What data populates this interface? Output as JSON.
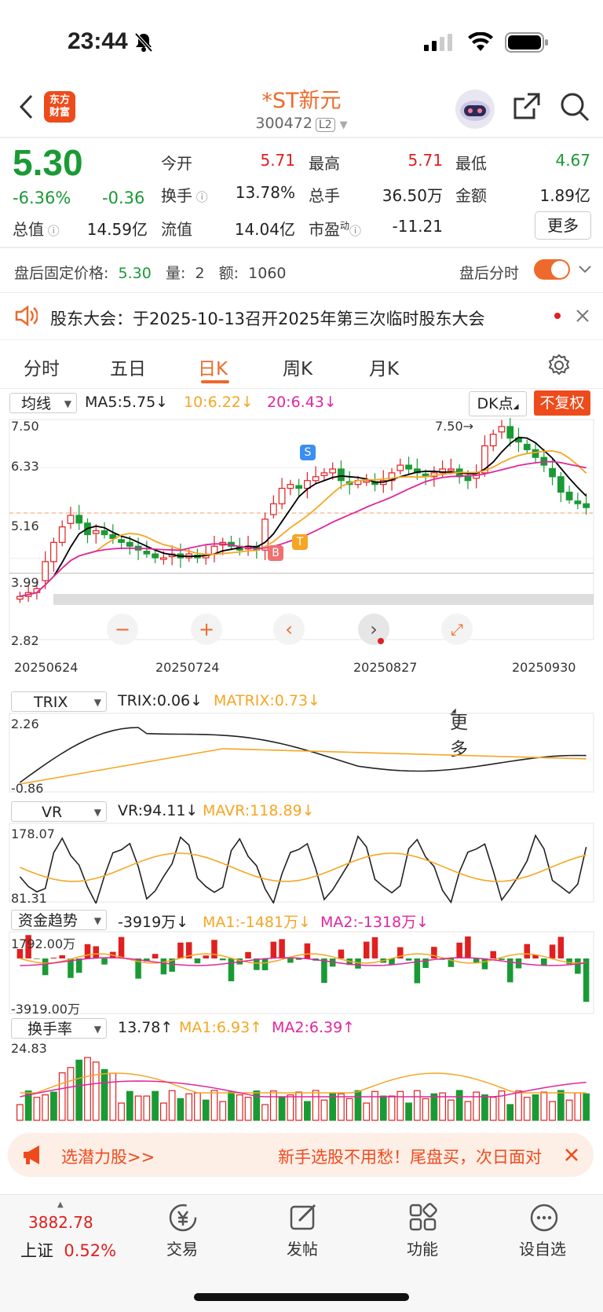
{
  "status_bar": {
    "time": "23:44"
  },
  "header": {
    "logo_text": "东方\n财富",
    "title": "*ST新元",
    "code": "300472",
    "level": "L2"
  },
  "quote": {
    "price": "5.30",
    "change_pct": "-6.36%",
    "change": "-0.36",
    "open_label": "今开",
    "open": "5.71",
    "high_label": "最高",
    "high": "5.71",
    "low_label": "最低",
    "low": "4.67",
    "turnover_label": "换手",
    "turnover": "13.78%",
    "volume_label": "总手",
    "volume": "36.50万",
    "amount_label": "金额",
    "amount": "1.89亿",
    "mktcap_label": "总值",
    "mktcap": "14.59亿",
    "float_label": "流值",
    "float": "14.04亿",
    "pe_label": "市盈",
    "pe_sup": "动",
    "pe": "-11.21",
    "more": "更多"
  },
  "after_hours": {
    "label": "盘后固定价格:",
    "price": "5.30",
    "vol_label": "量:",
    "vol": "2",
    "amt_label": "额:",
    "amt": "1060",
    "timeshare": "盘后分时"
  },
  "notice": {
    "text": "股东大会：于2025-10-13召开2025年第三次临时股东大会"
  },
  "tabs": [
    "分时",
    "五日",
    "日K",
    "周K",
    "月K",
    "更多"
  ],
  "active_tab": "日K",
  "kline": {
    "ma_selector": "均线",
    "ma5": "MA5:5.75↓",
    "ma10": "10:6.22↓",
    "ma20": "20:6.43↓",
    "dk": "DK点",
    "fuquan": "不复权",
    "y_labels": [
      "7.50",
      "6.33",
      "5.16",
      "3.99",
      "2.82"
    ],
    "high_mark": "7.50",
    "dates": [
      "20250624",
      "20250724",
      "20250827",
      "20250930"
    ]
  },
  "trix": {
    "name": "TRIX",
    "val": "TRIX:0.06↓",
    "ma": "MATRIX:0.73↓",
    "top": "2.26",
    "bottom": "-0.86"
  },
  "vr": {
    "name": "VR",
    "val": "VR:94.11↓",
    "ma": "MAVR:118.89↓",
    "top": "178.07",
    "bottom": "81.31"
  },
  "fund": {
    "name": "资金趋势",
    "val": "-3919万↓",
    "ma1": "MA1:-1481万↓",
    "ma2": "MA2:-1318万↓",
    "top": "1792.00万",
    "bottom": "-3919.00万"
  },
  "hsl": {
    "name": "换手率",
    "val": "13.78↑",
    "ma1": "MA1:6.93↑",
    "ma2": "MA2:6.39↑",
    "top": "24.83"
  },
  "ad": {
    "left": "选潜力股>>",
    "right": "新手选股不用愁！尾盘买，次日面对"
  },
  "bottom_bar": {
    "index_value": "3882.78",
    "index_name": "上证",
    "index_pct": "0.52%",
    "items": [
      "交易",
      "发帖",
      "功能",
      "设自选"
    ]
  },
  "colors": {
    "up": "#e02020",
    "down": "#1a9a35",
    "accent": "#ee6a2c",
    "ma5": "#000000",
    "ma10": "#f5a623",
    "ma20": "#e0269e"
  },
  "chart_data": {
    "type": "candlestick",
    "x_range": [
      "20250624",
      "20250930"
    ],
    "ylim": [
      2.82,
      7.5
    ],
    "close": [
      3.0,
      3.1,
      3.2,
      3.9,
      4.4,
      4.8,
      5.1,
      4.9,
      4.6,
      4.7,
      4.6,
      4.5,
      4.4,
      4.3,
      4.2,
      4.1,
      4.0,
      4.0,
      4.1,
      4.0,
      4.1,
      4.0,
      4.1,
      4.3,
      4.4,
      4.3,
      4.2,
      4.3,
      4.2,
      5.0,
      5.4,
      5.8,
      5.9,
      5.8,
      6.0,
      6.1,
      6.2,
      6.3,
      6.0,
      5.9,
      6.0,
      6.0,
      5.9,
      6.0,
      6.2,
      6.4,
      6.3,
      6.2,
      6.1,
      6.2,
      6.3,
      6.3,
      6.1,
      6.0,
      6.2,
      6.9,
      7.2,
      7.4,
      7.1,
      7.0,
      6.8,
      6.6,
      6.4,
      6.1,
      5.7,
      5.5,
      5.4,
      5.3
    ]
  }
}
